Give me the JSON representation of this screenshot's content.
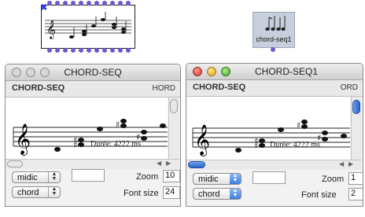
{
  "patch": {
    "close_glyph": "✖",
    "icon_name": "chord-seq-icon",
    "icon_label": "chord-seq1"
  },
  "windows": [
    {
      "title": "CHORD-SEQ",
      "header_left": "CHORD-SEQ",
      "header_right": "HORD",
      "duration_text": "Durée: 4222 ms",
      "approx_menu": "midic",
      "mode_menu": "chord",
      "zoom_label": "Zoom",
      "zoom_value": "10",
      "fontsize_label": "Font size",
      "fontsize_value": "24",
      "active": false
    },
    {
      "title": "CHORD-SEQ1",
      "header_left": "CHORD-SEQ",
      "header_right": "ORD",
      "duration_text": "Durée: 4222 ms",
      "approx_menu": "midic",
      "mode_menu": "chord",
      "zoom_label": "Zoom",
      "zoom_value": "1",
      "fontsize_label": "Font size",
      "fontsize_value": "2",
      "active": true
    }
  ]
}
